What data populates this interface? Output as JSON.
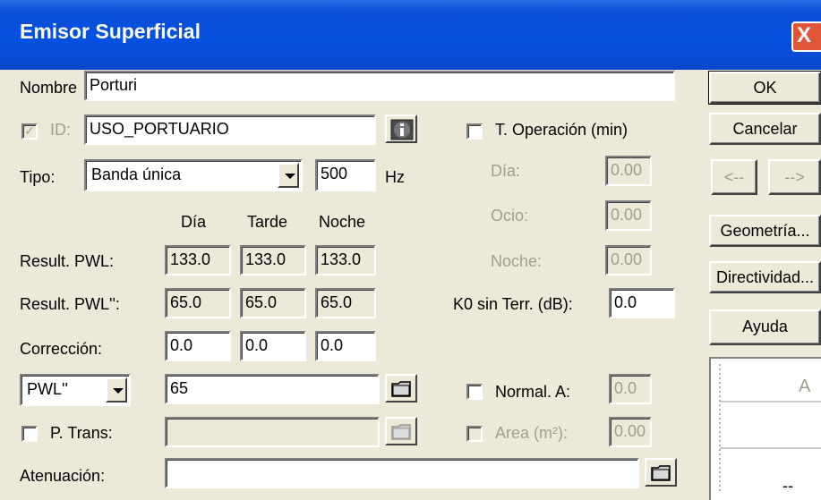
{
  "window": {
    "title": "Emisor Superficial",
    "close_label": "X"
  },
  "form": {
    "nombre_label": "Nombre",
    "nombre_value": "Porturi",
    "id_label": "ID:",
    "id_value": "USO_PORTUARIO",
    "tipo_label": "Tipo:",
    "tipo_value": "Banda única",
    "freq_value": "500",
    "freq_unit": "Hz",
    "col_dia": "Día",
    "col_tarde": "Tarde",
    "col_noche": "Noche",
    "pwl_label": "Result. PWL:",
    "pwl_values": [
      "133.0",
      "133.0",
      "133.0"
    ],
    "pwl2_label": "Result. PWL'':",
    "pwl2_values": [
      "65.0",
      "65.0",
      "65.0"
    ],
    "correccion_label": "Corrección:",
    "correccion_values": [
      "0.0",
      "0.0",
      "0.0"
    ],
    "pwl_type_value": "PWL''",
    "pwl_input_value": "65",
    "ptrans_label": "P. Trans:",
    "ptrans_value": "",
    "atenuacion_label": "Atenuación:",
    "atenuacion_value": ""
  },
  "operation": {
    "toperacion_label": "T. Operación (min)",
    "dia_label": "Día:",
    "dia_value": "0.00",
    "ocio_label": "Ocio:",
    "ocio_value": "0.00",
    "noche_label": "Noche:",
    "noche_value": "0.00",
    "k0_label": "K0 sin Terr. (dB):",
    "k0_value": "0.0",
    "normal_label": "Normal. A:",
    "normal_value": "0.0",
    "area_label": "Area (m²):",
    "area_value": "0.00"
  },
  "buttons": {
    "ok": "OK",
    "cancel": "Cancelar",
    "prev": "<--",
    "next": "-->",
    "geometria": "Geometría...",
    "directividad": "Directividad...",
    "ayuda": "Ayuda"
  },
  "preview": {
    "corner_label": "A",
    "bottom_label": "--"
  }
}
